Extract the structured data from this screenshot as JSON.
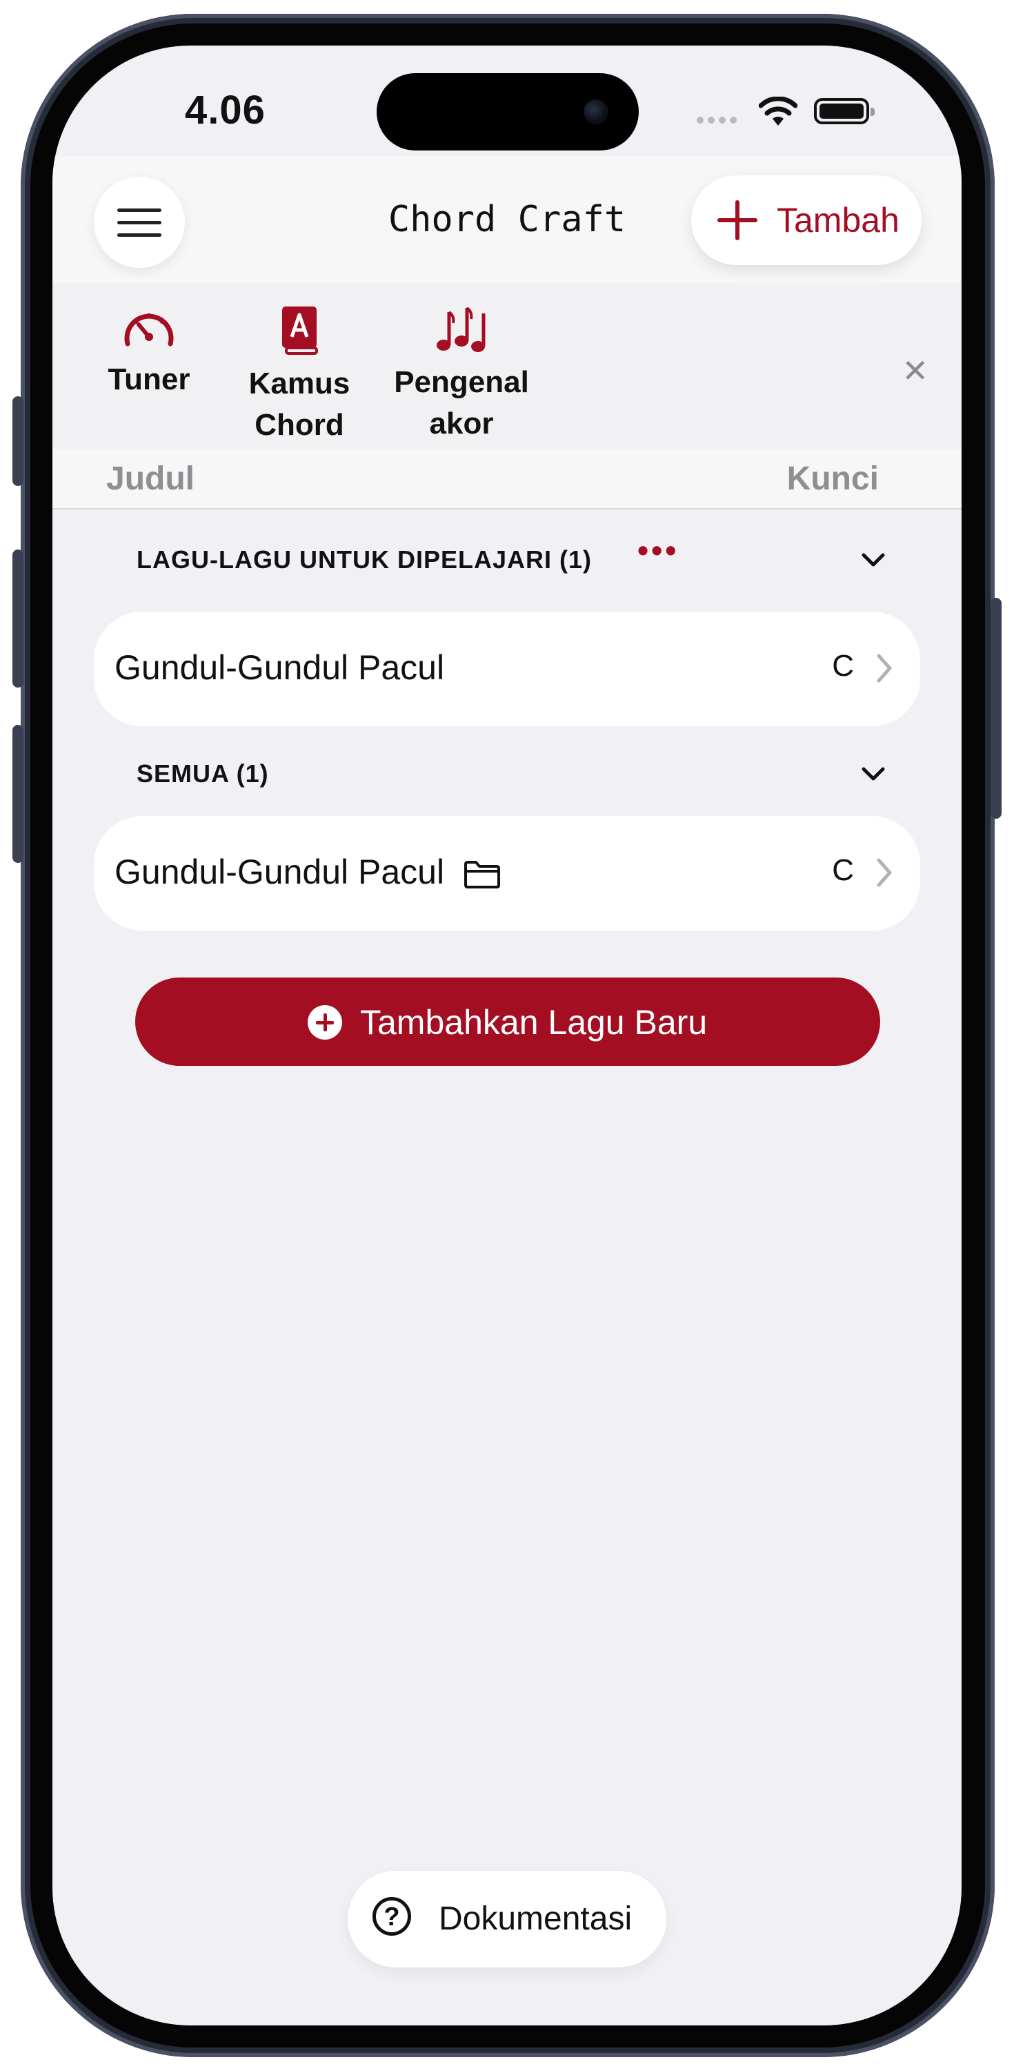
{
  "status_bar": {
    "time": "4.06"
  },
  "header": {
    "title": "Chord Craft",
    "add_label": "Tambah"
  },
  "toolbar": {
    "items": [
      {
        "label": "Tuner",
        "icon": "gauge-icon"
      },
      {
        "label_line1": "Kamus",
        "label_line2": "Chord",
        "icon": "dictionary-icon"
      },
      {
        "label_line1": "Pengenal",
        "label_line2": "akor",
        "icon": "music-notes-icon"
      }
    ]
  },
  "columns": {
    "title": "Judul",
    "key": "Kunci"
  },
  "sections": [
    {
      "header": "LAGU-LAGU UNTUK DIPELAJARI (1)",
      "songs": [
        {
          "title": "Gundul-Gundul Pacul",
          "key": "C"
        }
      ]
    },
    {
      "header": "SEMUA (1)",
      "songs": [
        {
          "title": "Gundul-Gundul Pacul",
          "key": "C"
        }
      ]
    }
  ],
  "actions": {
    "add_song": "Tambahkan Lagu Baru",
    "docs": "Dokumentasi"
  },
  "colors": {
    "accent": "#a30e22",
    "background": "#f1f0f5"
  }
}
